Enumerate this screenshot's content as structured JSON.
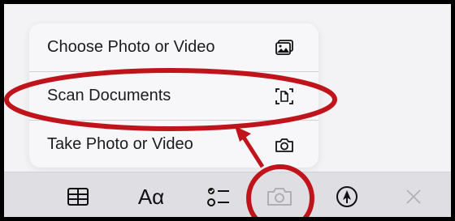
{
  "menu": {
    "items": [
      {
        "label": "Choose Photo or Video",
        "icon": "photo-library-icon"
      },
      {
        "label": "Scan Documents",
        "icon": "document-scan-icon"
      },
      {
        "label": "Take Photo or Video",
        "icon": "camera-icon"
      }
    ]
  },
  "toolbar": {
    "items": [
      {
        "name": "table-icon"
      },
      {
        "name": "text-format-icon",
        "label": "Aα"
      },
      {
        "name": "checklist-icon"
      },
      {
        "name": "camera-icon",
        "state": "disabled"
      },
      {
        "name": "markup-pen-icon"
      },
      {
        "name": "close-icon"
      }
    ]
  },
  "annotation": {
    "color": "#c0141c"
  }
}
